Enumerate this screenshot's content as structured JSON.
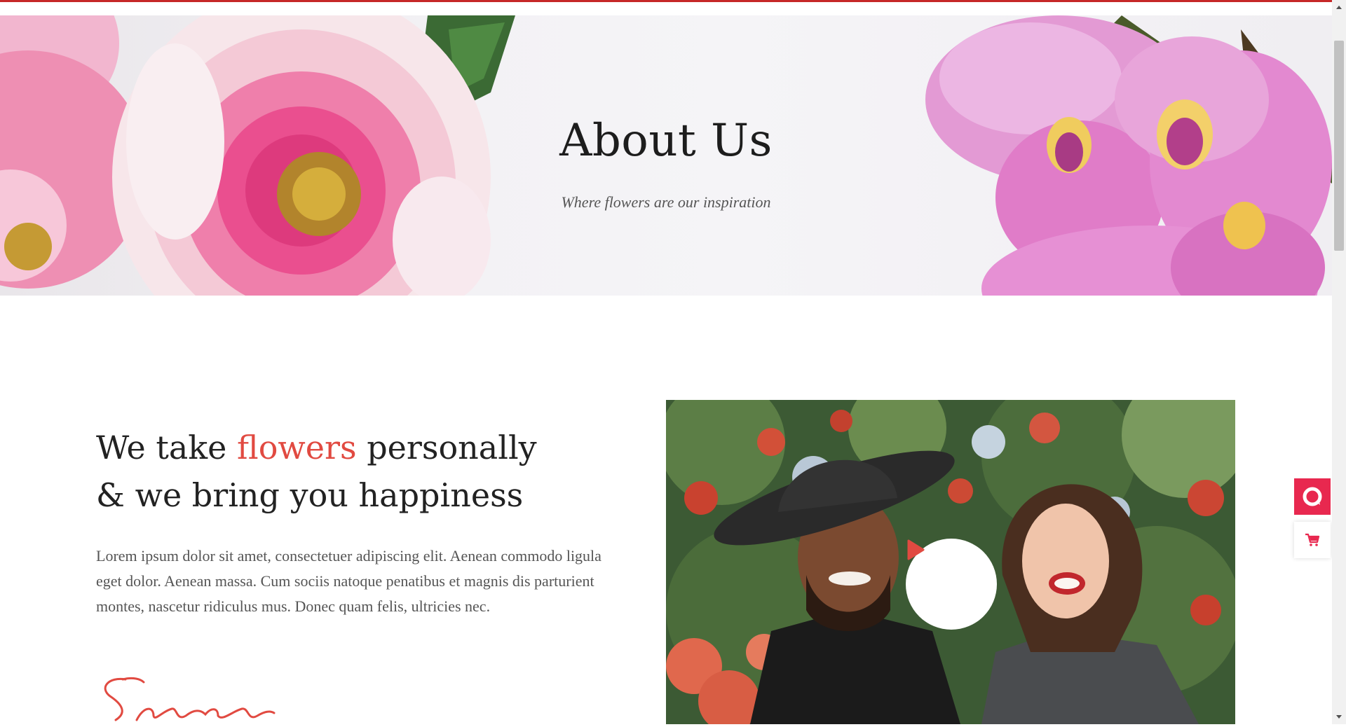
{
  "hero": {
    "title": "About Us",
    "subtitle": "Where flowers are our inspiration"
  },
  "intro": {
    "heading_part1": "We take ",
    "heading_accent": "flowers",
    "heading_part2": " personally",
    "heading_line2": "& we bring you happiness",
    "body": "Lorem ipsum dolor sit amet, consectetuer adipiscing elit. Aenean commodo ligula eget dolor. Aenean massa. Cum sociis natoque penatibus et magnis dis parturient montes, nascetur ridiculus mus. Donec quam felis, ultricies nec.",
    "signature": "Sara"
  },
  "video": {
    "play_icon": "play-icon"
  },
  "side_buttons": {
    "first_icon": "chat-bubble-icon",
    "second_icon": "cart-icon"
  },
  "colors": {
    "accent": "#e14a41",
    "brand_pink": "#e8284f",
    "top_line": "#c62828"
  }
}
